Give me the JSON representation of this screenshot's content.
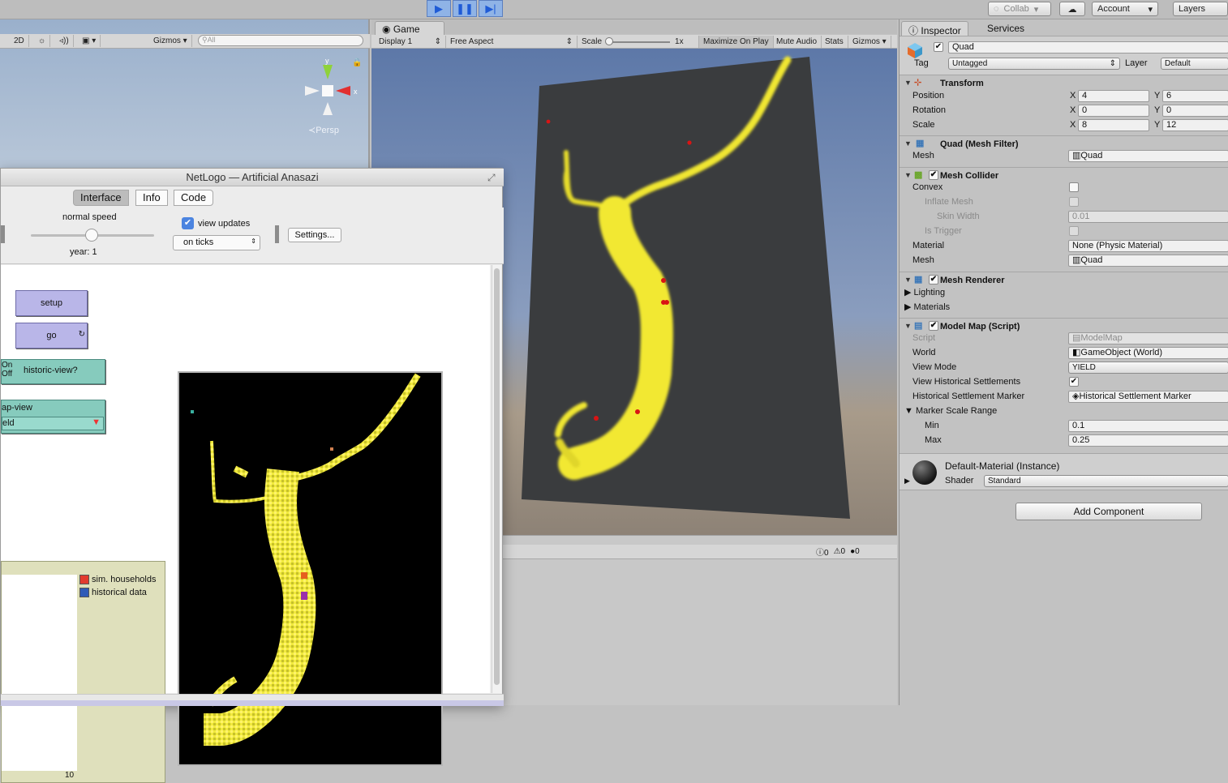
{
  "toolbar": {
    "collab": "Collab",
    "account": "Account",
    "layers": "Layers"
  },
  "scene": {
    "mode_2d": "2D",
    "gizmos": "Gizmos",
    "search_placeholder": "All",
    "persp": "Persp",
    "axis_x": "x",
    "axis_y": "y"
  },
  "game": {
    "tab": "Game",
    "display": "Display 1",
    "aspect": "Free Aspect",
    "scale_label": "Scale",
    "scale_value": "1x",
    "maximize": "Maximize On Play",
    "mute": "Mute Audio",
    "stats": "Stats",
    "gizmos": "Gizmos",
    "console_counts": [
      "0",
      "0",
      "0"
    ]
  },
  "inspector": {
    "tabs": [
      "Inspector",
      "Services"
    ],
    "object_name": "Quad",
    "tag_label": "Tag",
    "tag_value": "Untagged",
    "layer_label": "Layer",
    "layer_value": "Default",
    "transform": {
      "title": "Transform",
      "position_label": "Position",
      "position": {
        "x": "4",
        "y": "6"
      },
      "rotation_label": "Rotation",
      "rotation": {
        "x": "0",
        "y": "0"
      },
      "scale_label": "Scale",
      "scale": {
        "x": "8",
        "y": "12"
      }
    },
    "mesh_filter": {
      "title": "Quad (Mesh Filter)",
      "mesh_label": "Mesh",
      "mesh_value": "Quad"
    },
    "mesh_collider": {
      "title": "Mesh Collider",
      "convex": "Convex",
      "inflate": "Inflate Mesh",
      "skin_width": "Skin Width",
      "skin_value": "0.01",
      "is_trigger": "Is Trigger",
      "material_label": "Material",
      "material_value": "None (Physic Material)",
      "mesh_label": "Mesh",
      "mesh_value": "Quad"
    },
    "mesh_renderer": {
      "title": "Mesh Renderer",
      "lighting": "Lighting",
      "materials": "Materials"
    },
    "model_map": {
      "title": "Model Map (Script)",
      "script_label": "Script",
      "script_value": "ModelMap",
      "world_label": "World",
      "world_value": "GameObject (World)",
      "view_mode_label": "View Mode",
      "view_mode_value": "YIELD",
      "view_hist_label": "View Historical Settlements",
      "marker_label": "Historical Settlement Marker",
      "marker_value": "Historical Settlement Marker",
      "range_label": "Marker Scale Range",
      "min_label": "Min",
      "min_value": "0.1",
      "max_label": "Max",
      "max_value": "0.25"
    },
    "material": {
      "name": "Default-Material (Instance)",
      "shader_label": "Shader",
      "shader_value": "Standard"
    },
    "add_component": "Add Component"
  },
  "netlogo": {
    "title": "NetLogo — Artificial Anasazi",
    "tabs": [
      "Interface",
      "Info",
      "Code"
    ],
    "speed_label": "normal speed",
    "year_label": "year: 1",
    "view_updates": "view updates",
    "update_mode": "on ticks",
    "settings": "Settings...",
    "setup": "setup",
    "go": "go",
    "switch_on": "On",
    "switch_off": "Off",
    "switch_label": "historic-view?",
    "chooser_label": "ap-view",
    "chooser_value": "eld",
    "legend": [
      "sim. households",
      "historical data"
    ],
    "plot_tick": "10"
  },
  "colors": {
    "yield": "#ffff3a",
    "sim_households": "#e23b2e",
    "historical": "#2f5bb7",
    "button": "#b9b6e8",
    "switch": "#86cbbd"
  }
}
